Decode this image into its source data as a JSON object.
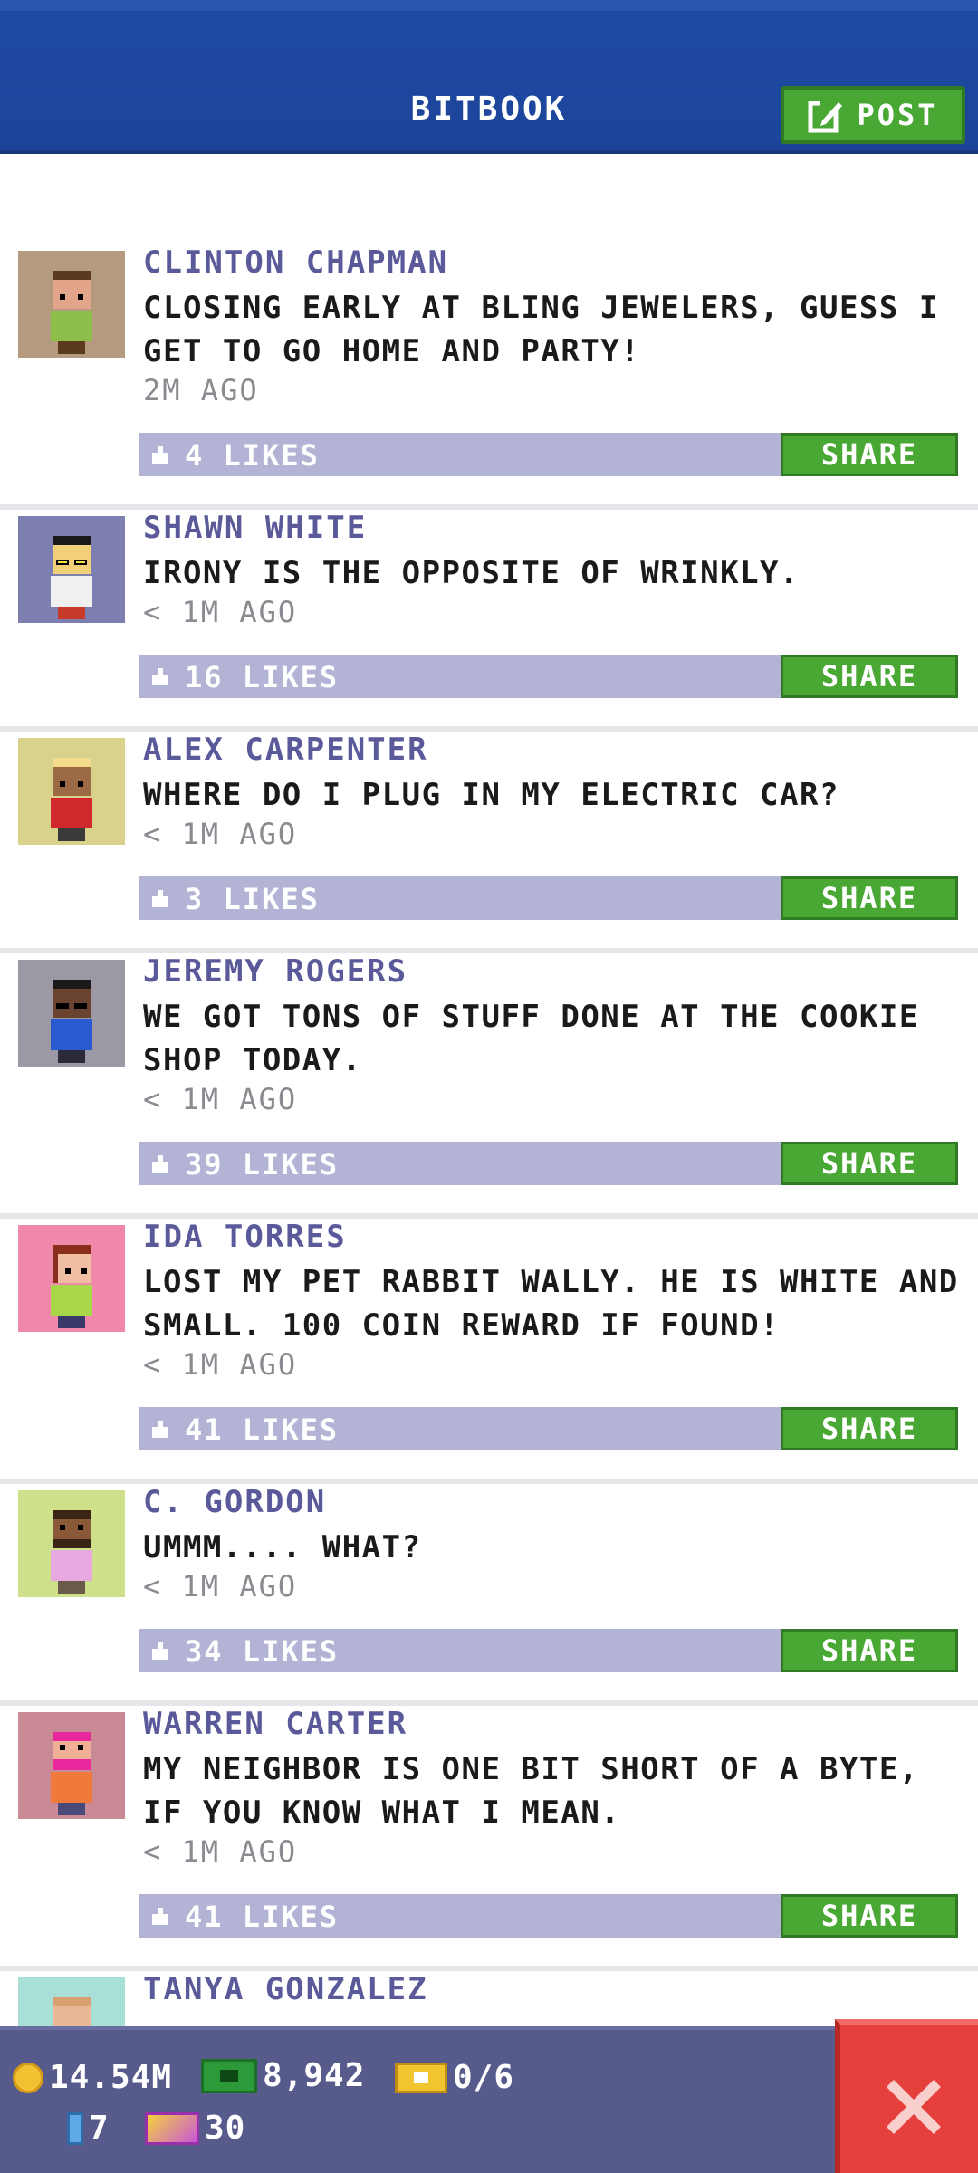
{
  "header": {
    "title": "BITBOOK",
    "post_label": "POST"
  },
  "posts": [
    {
      "name": "CLINTON CHAPMAN",
      "message": "CLOSING EARLY AT BLING JEWELERS, GUESS I GET TO GO HOME AND PARTY!",
      "time": "2M AGO",
      "likes": "4 LIKES",
      "share": "SHARE",
      "avatar_bg": "#b49a7e",
      "skin": "#e2a58a",
      "shirt": "#8ebf4a",
      "hair": "#5a3a20"
    },
    {
      "name": "SHAWN WHITE",
      "message": "IRONY IS THE OPPOSITE OF WRINKLY.",
      "time": "< 1M AGO",
      "likes": "16 LIKES",
      "share": "SHARE",
      "avatar_bg": "#7d7fb0",
      "skin": "#f2d07a",
      "shirt": "#f0f0f0",
      "hair": "#1a1a1a"
    },
    {
      "name": "ALEX CARPENTER",
      "message": "WHERE DO I PLUG IN MY ELECTRIC CAR?",
      "time": "< 1M AGO",
      "likes": "3 LIKES",
      "share": "SHARE",
      "avatar_bg": "#d8d28c",
      "skin": "#9c6a44",
      "shirt": "#d0282c",
      "hair": "#f3dc8a"
    },
    {
      "name": "JEREMY ROGERS",
      "message": "WE GOT TONS OF STUFF DONE AT THE COOKIE SHOP TODAY.",
      "time": "< 1M AGO",
      "likes": "39 LIKES",
      "share": "SHARE",
      "avatar_bg": "#9c98a4",
      "skin": "#6a4330",
      "shirt": "#2a5ad0",
      "hair": "#1a1a1a"
    },
    {
      "name": "IDA TORRES",
      "message": "LOST MY PET RABBIT WALLY. HE IS WHITE AND SMALL. 100 COIN REWARD IF FOUND!",
      "time": "< 1M AGO",
      "likes": "41 LIKES",
      "share": "SHARE",
      "avatar_bg": "#f088ac",
      "skin": "#f0bea0",
      "shirt": "#a8d84a",
      "hair": "#8a2e1c"
    },
    {
      "name": "C. GORDON",
      "message": "UMMM....  WHAT?",
      "time": "< 1M AGO",
      "likes": "34 LIKES",
      "share": "SHARE",
      "avatar_bg": "#cfe08a",
      "skin": "#8a5a38",
      "shirt": "#e8a8e0",
      "hair": "#3a2416"
    },
    {
      "name": "WARREN CARTER",
      "message": "MY NEIGHBOR IS ONE BIT SHORT OF A BYTE, IF YOU KNOW WHAT I MEAN.",
      "time": "< 1M AGO",
      "likes": "41 LIKES",
      "share": "SHARE",
      "avatar_bg": "#c98a96",
      "skin": "#f0b098",
      "shirt": "#f07a3a",
      "hair": "#e8289c"
    },
    {
      "name": "TANYA GONZALEZ",
      "message": "",
      "time": "",
      "likes": "",
      "share": "",
      "avatar_bg": "#a8e0d8",
      "skin": "#e8b896",
      "shirt": "#f0a060",
      "hair": "#d9a070"
    }
  ],
  "footer": {
    "coins": "14.54M",
    "cash": "8,942",
    "tickets": "0/6",
    "bux": "7",
    "vip": "30"
  }
}
